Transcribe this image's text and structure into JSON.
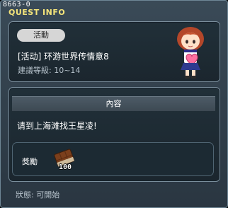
{
  "window": {
    "id_label": "8663-0",
    "title": "QUEST INFO"
  },
  "quest": {
    "tag": "活動",
    "name": "[活动] 环游世界传情意8",
    "level": "建議等級: 10~14",
    "avatar_icon": "npc-girl-holding-heart-icon"
  },
  "content": {
    "header": "內容",
    "text": "请到上海滩找王星凌!"
  },
  "reward": {
    "label": "獎勵",
    "item_icon": "chocolate-bar-icon",
    "quantity": "100"
  },
  "status": {
    "text": "狀態: 可開始"
  }
}
